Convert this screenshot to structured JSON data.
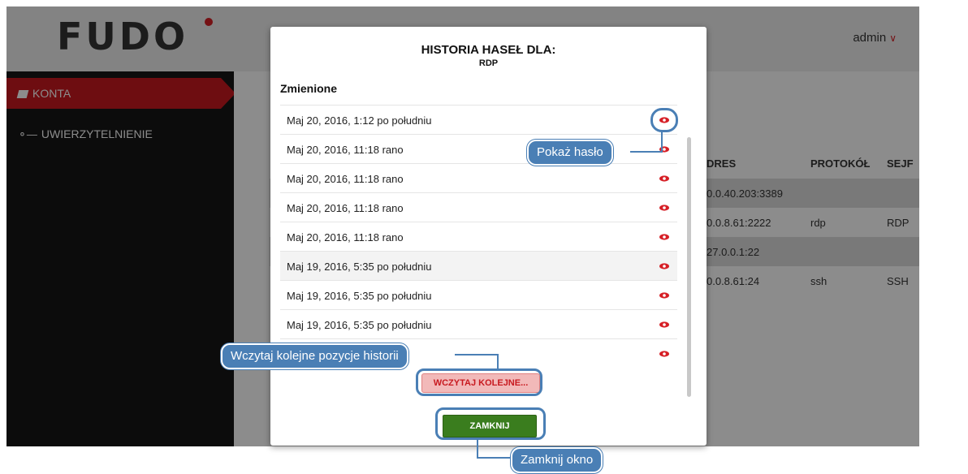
{
  "app": {
    "logo": "FUDO",
    "user": "admin"
  },
  "sidebar": {
    "items": [
      {
        "label": "KONTA",
        "icon": "book-icon"
      },
      {
        "label": "UWIERZYTELNIENIE",
        "icon": "key-icon"
      }
    ]
  },
  "table": {
    "headers": [
      "DRES",
      "PROTOKÓŁ",
      "SEJF"
    ],
    "rows": [
      {
        "address": "0.0.40.203:3389",
        "protocol": "",
        "safe": ""
      },
      {
        "address": "0.0.8.61:2222",
        "protocol": "rdp",
        "safe": "RDP"
      },
      {
        "address": "27.0.0.1:22",
        "protocol": "",
        "safe": ""
      },
      {
        "address": "0.0.8.61:24",
        "protocol": "ssh",
        "safe": "SSH"
      }
    ]
  },
  "modal": {
    "title": "HISTORIA HASEŁ DLA:",
    "subtitle": "RDP",
    "section": "Zmienione",
    "entries": [
      "Maj 20, 2016, 1:12 po południu",
      "Maj 20, 2016, 11:18 rano",
      "Maj 20, 2016, 11:18 rano",
      "Maj 20, 2016, 11:18 rano",
      "Maj 20, 2016, 11:18 rano",
      "Maj 19, 2016, 5:35 po południu",
      "Maj 19, 2016, 5:35 po południu",
      "Maj 19, 2016, 5:35 po południu",
      ""
    ],
    "load_more_label": "WCZYTAJ KOLEJNE...",
    "close_label": "ZAMKNIJ"
  },
  "callouts": {
    "show_password": "Pokaż hasło",
    "load_more": "Wczytaj kolejne pozycje historii",
    "close": "Zamknij okno"
  },
  "colors": {
    "accent": "#c8191f",
    "callout": "#4a7fb5",
    "close_button": "#3a7d1e",
    "sidebar": "#161616"
  }
}
